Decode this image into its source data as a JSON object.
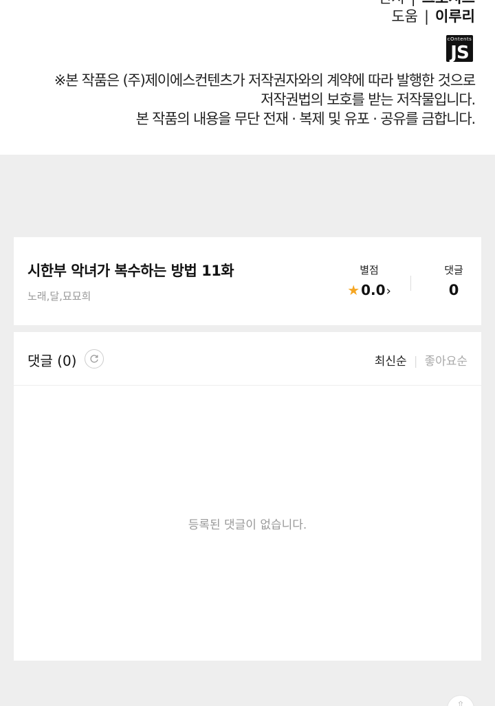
{
  "credits": {
    "rows": [
      {
        "role": "편저",
        "name": "그노시스"
      },
      {
        "role": "도움",
        "name": "이루리"
      }
    ],
    "separator": "|",
    "logo": {
      "small_text": "cOntents",
      "big_text": "JS"
    }
  },
  "notice": {
    "lines": [
      "※본 작품은 (주)제이에스컨텐츠가 저작권자와의 계약에 따라 발행한 것으로",
      "저작권법의 보호를 받는 저작물입니다.",
      "본 작품의 내용을 무단 전재 · 복제 및 유포 · 공유를 금합니다."
    ]
  },
  "episode": {
    "title": "시한부 악녀가 복수하는 방법 11화",
    "authors": "노래,달,묘묘희",
    "rating_label": "별점",
    "rating_value": "0.0",
    "rating_chevron": "›",
    "comment_label": "댓글",
    "comment_count": "0",
    "star_color": "#f5a623"
  },
  "comments": {
    "title": "댓글 (0)",
    "refresh_icon": "refresh-icon",
    "sort_latest": "최신순",
    "sort_divider": "|",
    "sort_likes": "좋아요순",
    "empty_message": "등록된 댓글이 없습니다."
  },
  "scroll_top": {
    "icon": "arrow-up-icon",
    "glyph": "⇧"
  }
}
